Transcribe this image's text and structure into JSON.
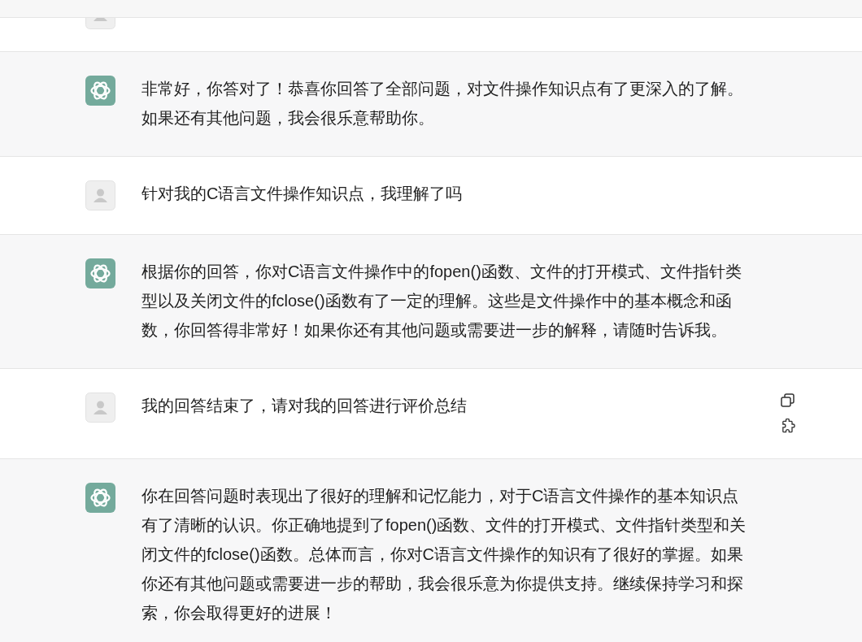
{
  "messages": [
    {
      "kind": "user"
    },
    {
      "kind": "assistant",
      "text": "非常好，你答对了！恭喜你回答了全部问题，对文件操作知识点有了更深入的了解。如果还有其他问题，我会很乐意帮助你。"
    },
    {
      "kind": "user",
      "text": "针对我的C语言文件操作知识点，我理解了吗"
    },
    {
      "kind": "assistant",
      "text": "根据你的回答，你对C语言文件操作中的fopen()函数、文件的打开模式、文件指针类型以及关闭文件的fclose()函数有了一定的理解。这些是文件操作中的基本概念和函数，你回答得非常好！如果你还有其他问题或需要进一步的解释，请随时告诉我。"
    },
    {
      "kind": "user",
      "text": "我的回答结束了，请对我的回答进行评价总结",
      "actions": true
    },
    {
      "kind": "assistant",
      "text": "你在回答问题时表现出了很好的理解和记忆能力，对于C语言文件操作的基本知识点有了清晰的认识。你正确地提到了fopen()函数、文件的打开模式、文件指针类型和关闭文件的fclose()函数。总体而言，你对C语言文件操作的知识有了很好的掌握。如果你还有其他问题或需要进一步的帮助，我会很乐意为你提供支持。继续保持学习和探索，你会取得更好的进展！"
    }
  ]
}
